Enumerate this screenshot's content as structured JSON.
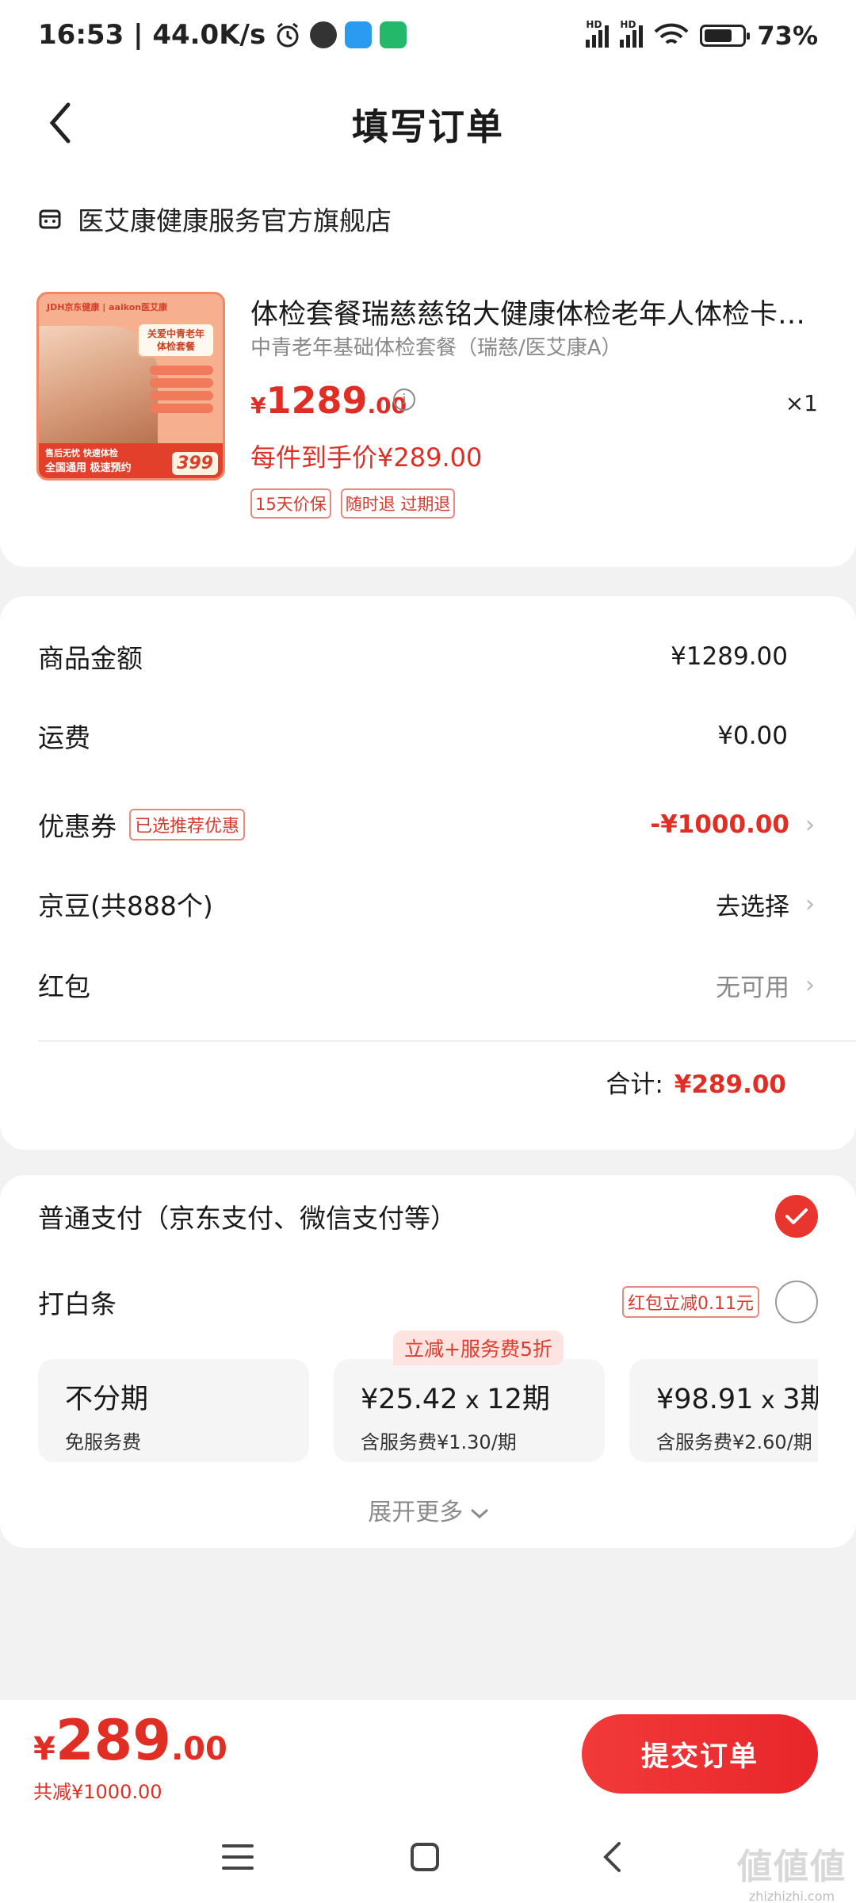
{
  "status_bar": {
    "time_speed": "16:53 | 44.0K/s",
    "battery": "73%",
    "battery_level": 0.73
  },
  "nav": {
    "title": "填写订单"
  },
  "store": {
    "name": "医艾康健康服务官方旗舰店",
    "icon": "store-icon"
  },
  "product": {
    "title": "体检套餐瑞慈慈铭大健康体检老年人体检卡全国通用",
    "subtitle": "中青老年基础体检套餐（瑞慈/医艾康A）",
    "price_currency": "¥",
    "price_int": "1289",
    "price_dec": ".00",
    "quantity": "×1",
    "hand_price": "每件到手价¥289.00",
    "tags": [
      "15天价保",
      "随时退 过期退"
    ],
    "image": {
      "brand": "JDH京东健康 | aaikon医艾康",
      "bubble": "关爱中青老年 体检套餐",
      "footer_line1": "售后无忧 快速体检",
      "footer_line2": "全国通用 极速预约",
      "price_label": "399"
    }
  },
  "fees": {
    "goods_label": "商品金额",
    "goods_value": "¥1289.00",
    "shipping_label": "运费",
    "shipping_value": "¥0.00",
    "coupon_label": "优惠券",
    "coupon_badge": "已选推荐优惠",
    "coupon_value": "-¥1000.00",
    "jingdou_label": "京豆(共888个)",
    "jingdou_value": "去选择",
    "redpacket_label": "红包",
    "redpacket_value": "无可用",
    "total_label": "合计:",
    "total_value": "¥289.00"
  },
  "payment": {
    "normal_label": "普通支付（京东支付、微信支付等）",
    "baitiao_label": "打白条",
    "baitiao_badge": "红包立减0.11元",
    "plan_badge": "立减+服务费5折",
    "plans": [
      {
        "main": "不分期",
        "sub": "免服务费"
      },
      {
        "main": "¥25.42",
        "times": " x ",
        "period": "12期",
        "sub": "含服务费¥1.30/期"
      },
      {
        "main": "¥98.91",
        "times": " x ",
        "period": "3期",
        "sub": "含服务费¥2.60/期"
      }
    ],
    "expand": "展开更多"
  },
  "bottom": {
    "price_currency": "¥",
    "price_int": "289",
    "price_dec": ".00",
    "saved": "共减¥1000.00",
    "submit": "提交订单"
  },
  "watermark": {
    "text": "zhizhizhi.com"
  },
  "colors": {
    "accent_red": "#e02e24",
    "button_red": "#f23a3a"
  }
}
